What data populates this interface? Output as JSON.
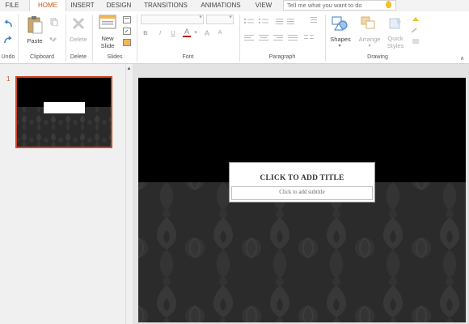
{
  "tabs": [
    {
      "label": "FILE",
      "active": false
    },
    {
      "label": "HOME",
      "active": true
    },
    {
      "label": "INSERT",
      "active": false
    },
    {
      "label": "DESIGN",
      "active": false
    },
    {
      "label": "TRANSITIONS",
      "active": false
    },
    {
      "label": "ANIMATIONS",
      "active": false
    },
    {
      "label": "VIEW",
      "active": false
    }
  ],
  "tell_me": {
    "placeholder": "Tell me what you want to do"
  },
  "ribbon": {
    "groups": {
      "undo": "Undo",
      "clipboard": "Clipboard",
      "delete": "Delete",
      "slides": "Slides",
      "font": "Font",
      "paragraph": "Paragraph",
      "drawing": "Drawing"
    },
    "buttons": {
      "paste": "Paste",
      "delete": "Delete",
      "new_slide_line1": "New",
      "new_slide_line2": "Slide",
      "shapes": "Shapes",
      "arrange": "Arrange",
      "quick_styles_line1": "Quick",
      "quick_styles_line2": "Styles"
    },
    "font_buttons": {
      "bold": "B",
      "italic": "I",
      "underline": "U",
      "font_color": "A",
      "grow": "A",
      "shrink": "A"
    }
  },
  "thumbnails": [
    {
      "number": "1"
    }
  ],
  "slide": {
    "title_placeholder": "CLICK TO ADD TITLE",
    "subtitle_placeholder": "Click to add subtitle"
  },
  "colors": {
    "accent": "#c55a11",
    "selection_border": "#d24726",
    "slide_top": "#000000",
    "damask_bg": "#2a2a2a",
    "damask_pattern": "#3a3a3a"
  }
}
